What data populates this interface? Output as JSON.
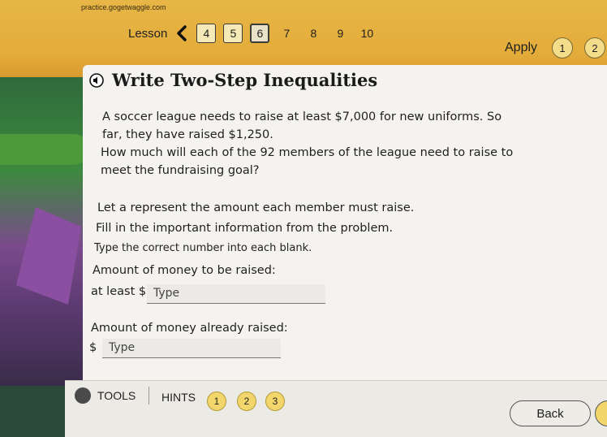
{
  "browser": {
    "url": "practice.gogetwaggle.com"
  },
  "lesson_nav": {
    "label": "Lesson",
    "buttons": [
      "4",
      "5",
      "6",
      "7",
      "8",
      "9",
      "10"
    ],
    "current": "6"
  },
  "apply": {
    "label": "Apply",
    "buttons": [
      "1",
      "2"
    ]
  },
  "page": {
    "title": "Write Two-Step Inequalities",
    "paragraph1": "A soccer league needs to raise at least $7,000 for new uniforms. So far, they have raised $1,250.",
    "paragraph2": "How much will each of the 92 members of the league need to raise to meet the fundraising goal?",
    "let_text": "Let a represent the amount each member must raise.",
    "fill_text": "Fill in the important information from the problem.",
    "instruction": "Type the correct number into each blank.",
    "field1": {
      "label": "Amount of money to be raised:",
      "prefix": "at least $",
      "placeholder": "Type"
    },
    "field2": {
      "label": "Amount of money already raised:",
      "prefix": "$",
      "placeholder": "Type"
    }
  },
  "toolbar": {
    "tools_label": "TOOLS",
    "hints_label": "HINTS",
    "hints": [
      "1",
      "2",
      "3"
    ],
    "back_label": "Back"
  }
}
